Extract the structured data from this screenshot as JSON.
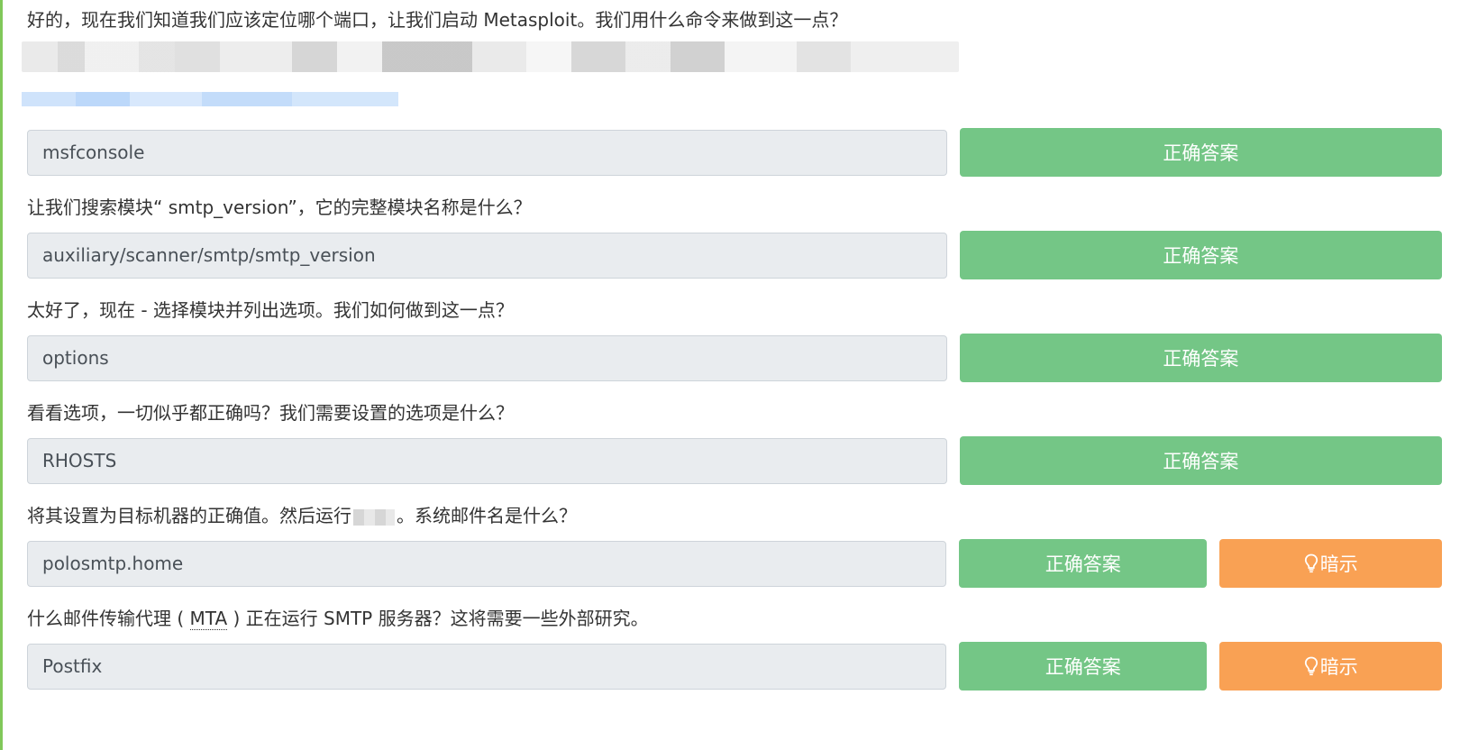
{
  "questions": [
    {
      "text": "好的，现在我们知道我们应该定位哪个端口，让我们启动 Metasploit。我们用什么命令来做到这一点？",
      "answer": "msfconsole",
      "correct_label": "正确答案"
    },
    {
      "text": "让我们搜索模块“ smtp_version”，它的完整模块名称是什么？",
      "answer": "auxiliary/scanner/smtp/smtp_version",
      "correct_label": "正确答案"
    },
    {
      "text": "太好了，现在 - 选择模块并列出选项。我们如何做到这一点？",
      "answer": "options",
      "correct_label": "正确答案"
    },
    {
      "text": "看看选项，一切似乎都正确吗？我们需要设置的选项是什么？",
      "answer": "RHOSTS",
      "correct_label": "正确答案"
    },
    {
      "text_before": "将其设置为目标机器的正确值。然后运行",
      "text_after": "。系统邮件名是什么？",
      "answer": "polosmtp.home",
      "correct_label": "正确答案",
      "hint_label": "暗示"
    },
    {
      "text_before": "什么邮件传输代理 (",
      "abbr": "MTA",
      "text_after": ") 正在运行 SMTP 服务器？这将需要一些外部研究。",
      "answer": "Postfix",
      "correct_label": "正确答案",
      "hint_label": "暗示"
    }
  ],
  "colors": {
    "correct_button": "#74c686",
    "hint_button": "#f9a154",
    "input_background": "#e9ecef",
    "left_accent": "#80c85a"
  },
  "icons": {
    "hint": "lightbulb-icon"
  }
}
